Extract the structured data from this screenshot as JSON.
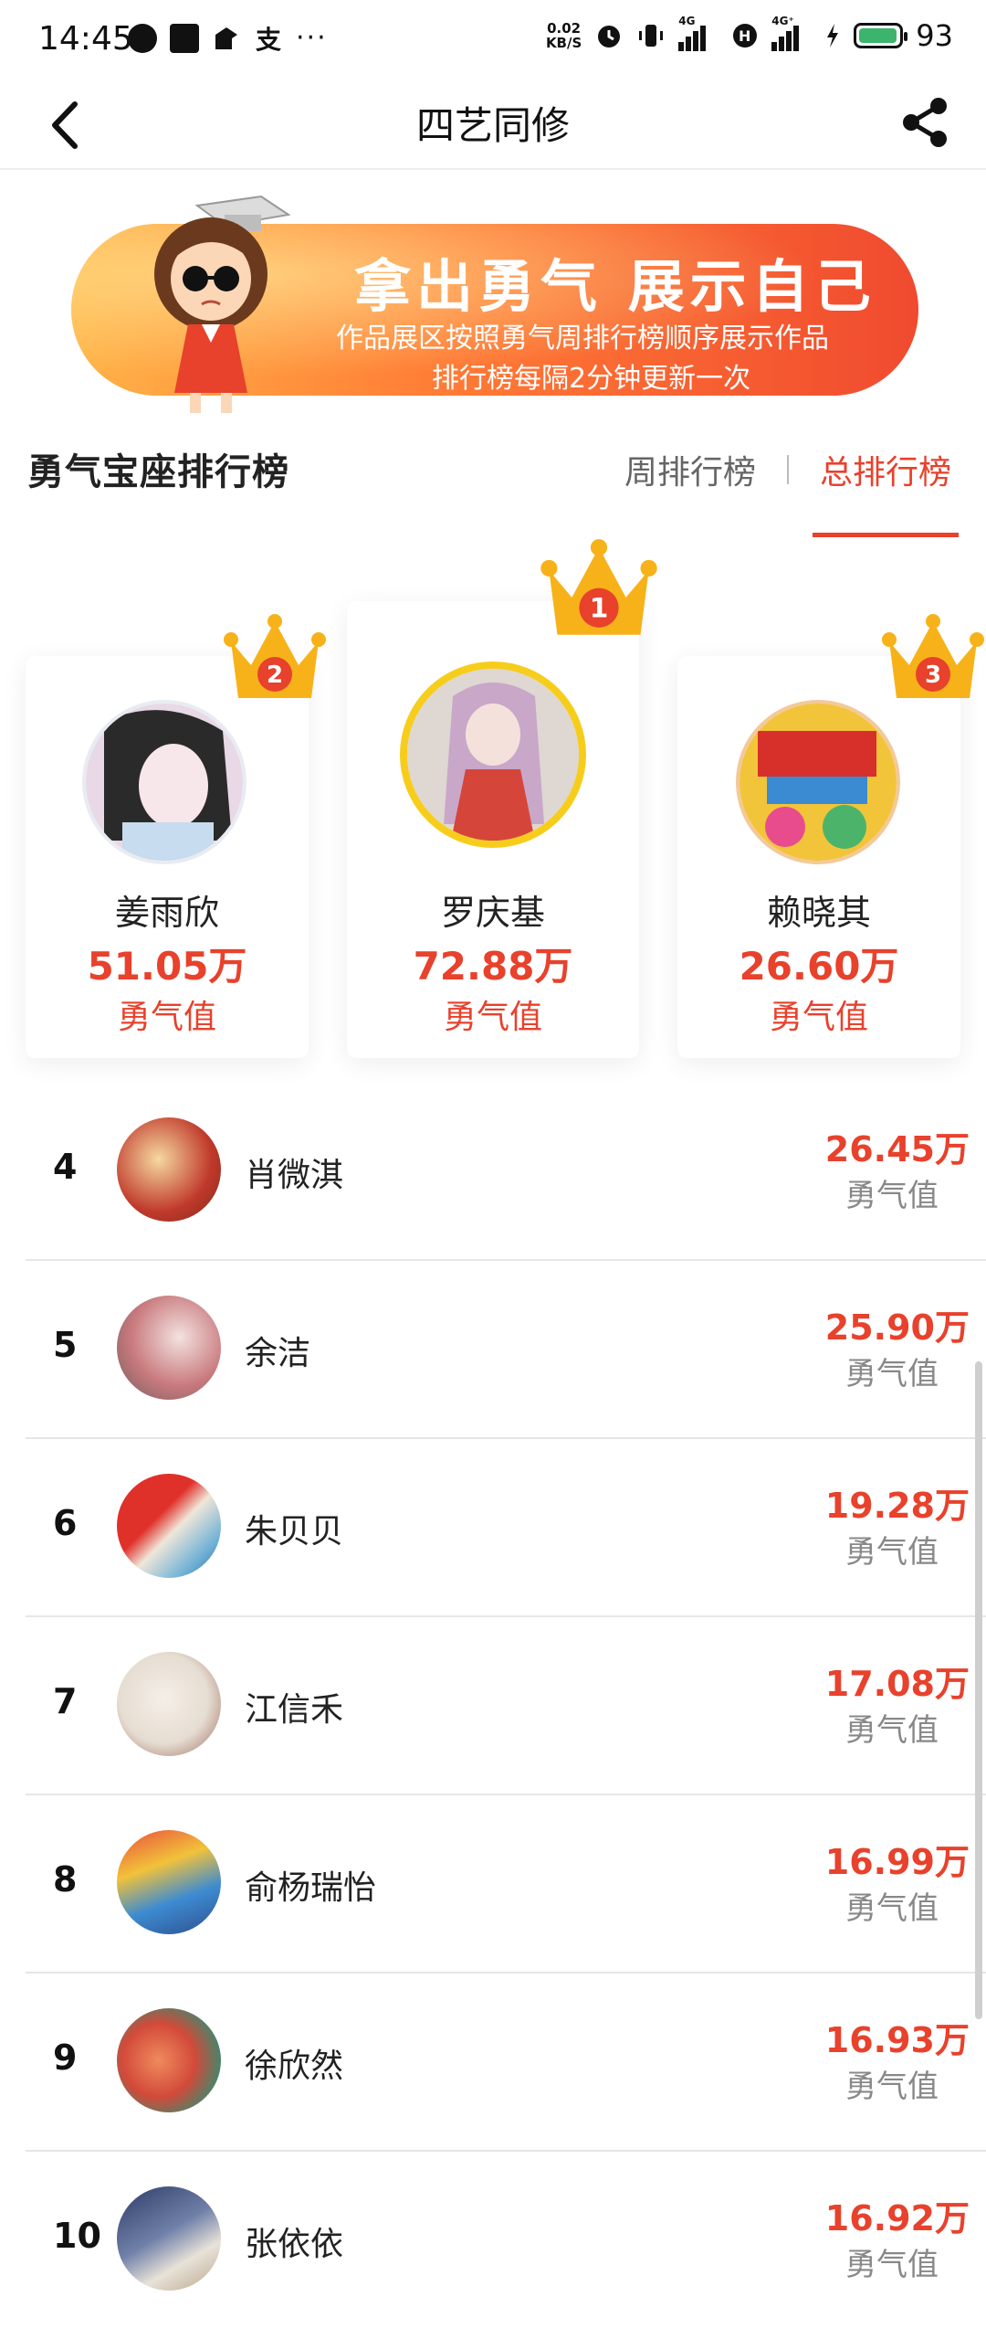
{
  "status_bar": {
    "time": "14:45",
    "net_speed_value": "0.02",
    "net_speed_unit": "KB/S",
    "battery_level": "93",
    "net_type_1": "4G",
    "net_type_2": "4G⁺",
    "icons": [
      "chat-icon",
      "media-icon",
      "notification-icon",
      "alipay-icon",
      "more-dots-icon"
    ],
    "more_dots": "···"
  },
  "nav": {
    "title": "四艺同修",
    "back_icon": "chevron-left-icon",
    "share_icon": "share-icon"
  },
  "banner": {
    "headline": "拿出勇气 展示自己",
    "line1": "作品展区按照勇气周排行榜顺序展示作品",
    "line2": "排行榜每隔2分钟更新一次"
  },
  "leaderboard": {
    "title": "勇气宝座排行榜",
    "tabs": [
      {
        "label": "周排行榜",
        "active": false
      },
      {
        "label": "总排行榜",
        "active": true
      }
    ],
    "podium": [
      {
        "rank": "2",
        "name": "姜雨欣",
        "value": "51.05万",
        "unit": "勇气值"
      },
      {
        "rank": "1",
        "name": "罗庆基",
        "value": "72.88万",
        "unit": "勇气值"
      },
      {
        "rank": "3",
        "name": "赖晓其",
        "value": "26.60万",
        "unit": "勇气值"
      }
    ],
    "rows": [
      {
        "rank": "4",
        "name": "肖微淇",
        "value": "26.45万",
        "unit": "勇气值"
      },
      {
        "rank": "5",
        "name": "余洁",
        "value": "25.90万",
        "unit": "勇气值"
      },
      {
        "rank": "6",
        "name": "朱贝贝",
        "value": "19.28万",
        "unit": "勇气值"
      },
      {
        "rank": "7",
        "name": "江信禾",
        "value": "17.08万",
        "unit": "勇气值"
      },
      {
        "rank": "8",
        "name": "俞杨瑞怡",
        "value": "16.99万",
        "unit": "勇气值"
      },
      {
        "rank": "9",
        "name": "徐欣然",
        "value": "16.93万",
        "unit": "勇气值"
      },
      {
        "rank": "10",
        "name": "张依依",
        "value": "16.92万",
        "unit": "勇气值"
      }
    ]
  },
  "colors": {
    "accent": "#e8412c",
    "crown_gold": "#f7b21a",
    "banner_start": "#ffb347",
    "banner_end": "#f04a2f"
  }
}
